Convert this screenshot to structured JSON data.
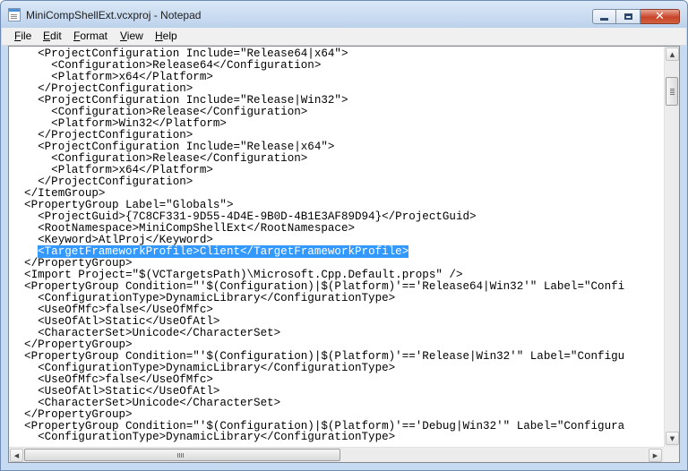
{
  "window": {
    "title": "MiniCompShellExt.vcxproj - Notepad",
    "icons": {
      "app": "notepad-icon",
      "minimize": "minimize-icon",
      "maximize": "maximize-icon",
      "close": "close-icon"
    },
    "close_glyph": "✕"
  },
  "menu": {
    "items": [
      {
        "accel": "F",
        "rest": "ile"
      },
      {
        "accel": "E",
        "rest": "dit"
      },
      {
        "accel": "F",
        "rest": "ormat",
        "accel_pos": "start"
      },
      {
        "accel": "V",
        "rest": "iew"
      },
      {
        "accel": "H",
        "rest": "elp"
      }
    ]
  },
  "editor": {
    "lines_before_selection": "    <ProjectConfiguration Include=\"Release64|x64\">\n      <Configuration>Release64</Configuration>\n      <Platform>x64</Platform>\n    </ProjectConfiguration>\n    <ProjectConfiguration Include=\"Release|Win32\">\n      <Configuration>Release</Configuration>\n      <Platform>Win32</Platform>\n    </ProjectConfiguration>\n    <ProjectConfiguration Include=\"Release|x64\">\n      <Configuration>Release</Configuration>\n      <Platform>x64</Platform>\n    </ProjectConfiguration>\n  </ItemGroup>\n  <PropertyGroup Label=\"Globals\">\n    <ProjectGuid>{7C8CF331-9D55-4D4E-9B0D-4B1E3AF89D94}</ProjectGuid>\n    <RootNamespace>MiniCompShellExt</RootNamespace>\n    <Keyword>AtlProj</Keyword>\n    ",
    "selected_text": "<TargetFrameworkProfile>Client</TargetFrameworkProfile>",
    "lines_after_selection": "\n  </PropertyGroup>\n  <Import Project=\"$(VCTargetsPath)\\Microsoft.Cpp.Default.props\" />\n  <PropertyGroup Condition=\"'$(Configuration)|$(Platform)'=='Release64|Win32'\" Label=\"Confi\n    <ConfigurationType>DynamicLibrary</ConfigurationType>\n    <UseOfMfc>false</UseOfMfc>\n    <UseOfAtl>Static</UseOfAtl>\n    <CharacterSet>Unicode</CharacterSet>\n  </PropertyGroup>\n  <PropertyGroup Condition=\"'$(Configuration)|$(Platform)'=='Release|Win32'\" Label=\"Configu\n    <ConfigurationType>DynamicLibrary</ConfigurationType>\n    <UseOfMfc>false</UseOfMfc>\n    <UseOfAtl>Static</UseOfAtl>\n    <CharacterSet>Unicode</CharacterSet>\n  </PropertyGroup>\n  <PropertyGroup Condition=\"'$(Configuration)|$(Platform)'=='Debug|Win32'\" Label=\"Configura\n    <ConfigurationType>DynamicLibrary</ConfigurationType>"
  },
  "scrollbars": {
    "up_arrow": "▲",
    "down_arrow": "▼",
    "left_arrow": "◀",
    "right_arrow": "▶",
    "icons": {
      "up": "up-arrow-icon",
      "down": "down-arrow-icon",
      "left": "left-arrow-icon",
      "right": "right-arrow-icon"
    }
  },
  "colors": {
    "selection_bg": "#3399ff",
    "selection_fg": "#ffffff",
    "close_button": "#c7442a"
  }
}
